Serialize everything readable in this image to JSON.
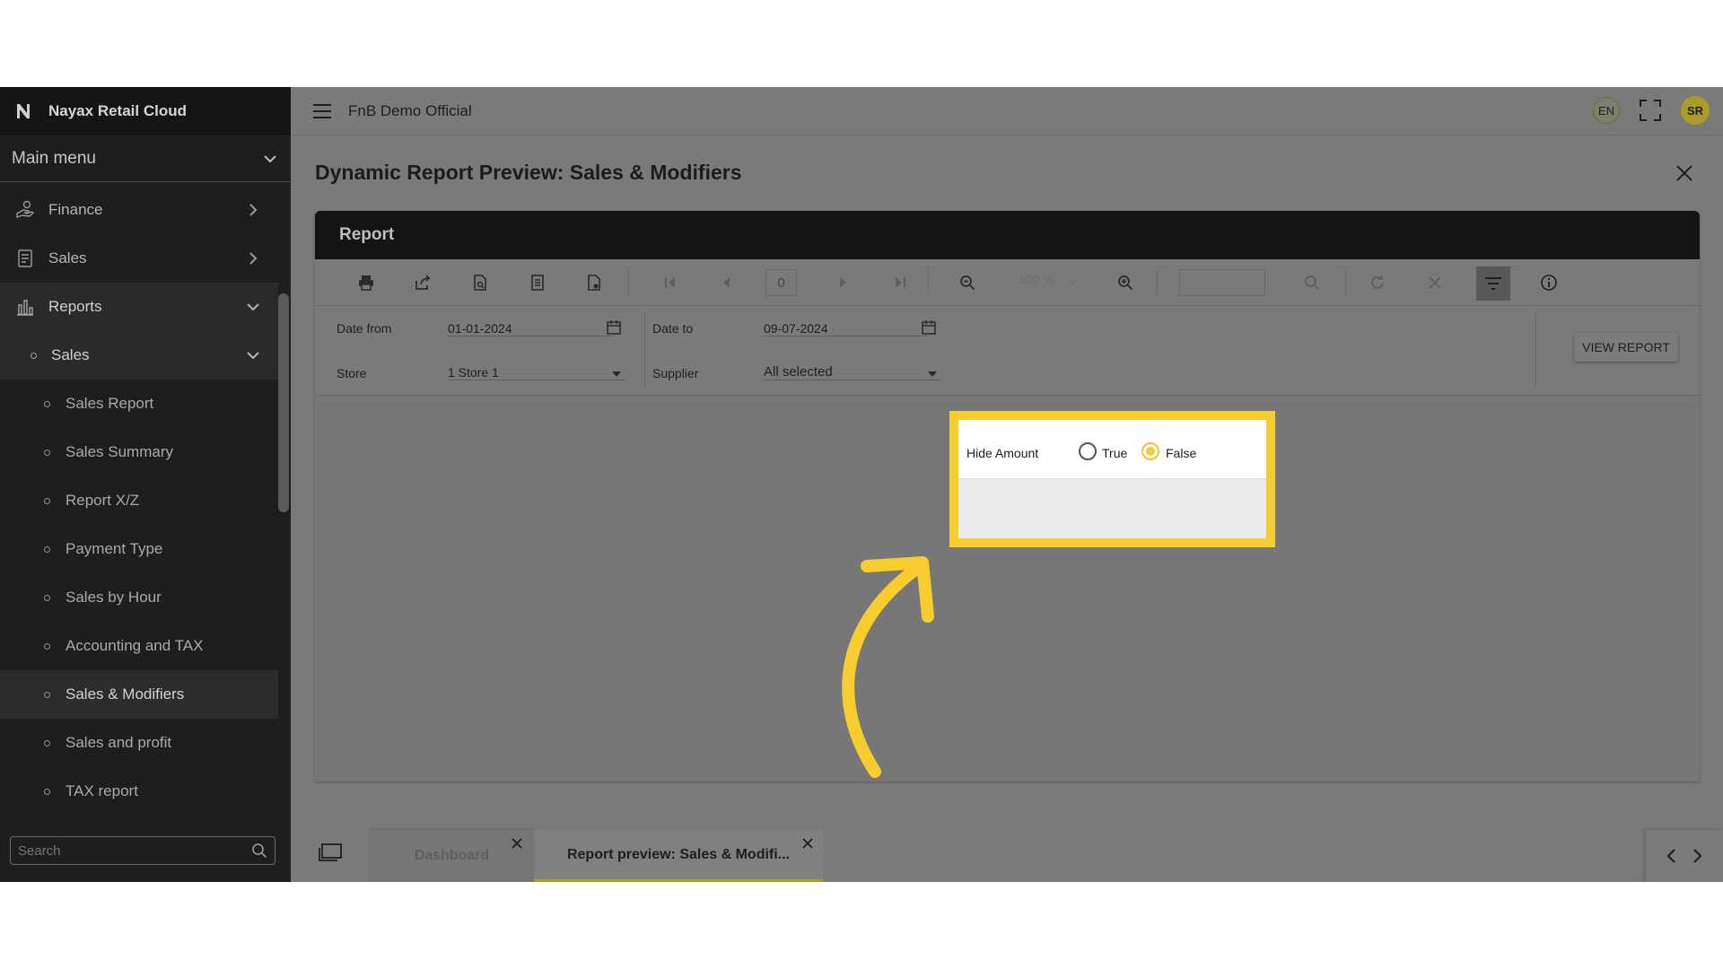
{
  "app": {
    "title": "Nayax Retail Cloud",
    "org": "FnB Demo Official",
    "lang": "EN",
    "user_initials": "SR"
  },
  "sidebar": {
    "main_menu": "Main menu",
    "items": [
      {
        "label": "Finance"
      },
      {
        "label": "Sales"
      },
      {
        "label": "Reports"
      }
    ],
    "reports_sub": {
      "label": "Sales"
    },
    "sales_items": [
      "Sales Report",
      "Sales Summary",
      "Report X/Z",
      "Payment Type",
      "Sales by Hour",
      "Accounting and TAX",
      "Sales & Modifiers",
      "Sales and profit",
      "TAX report"
    ],
    "active_item": "Sales & Modifiers",
    "search_placeholder": "Search"
  },
  "page": {
    "title": "Dynamic Report Preview: Sales & Modifiers"
  },
  "report": {
    "header": "Report",
    "page_number": "0",
    "zoom": "100 %",
    "params": {
      "date_from_label": "Date from",
      "date_from": "01-01-2024",
      "date_to_label": "Date to",
      "date_to": "09-07-2024",
      "store_label": "Store",
      "store": "1 Store 1",
      "supplier_label": "Supplier",
      "supplier": "All selected",
      "hide_amount_label": "Hide Amount",
      "hide_amount_options": [
        "True",
        "False"
      ],
      "hide_amount_selected": "False"
    },
    "view_button": "VIEW REPORT"
  },
  "tabs": [
    {
      "label": "Dashboard"
    },
    {
      "label": "Report preview: Sales & Modifi..."
    }
  ],
  "colors": {
    "highlight": "#f6cc2f",
    "accent": "#f3cf33",
    "sidebar_bg": "#1e1e1e"
  }
}
